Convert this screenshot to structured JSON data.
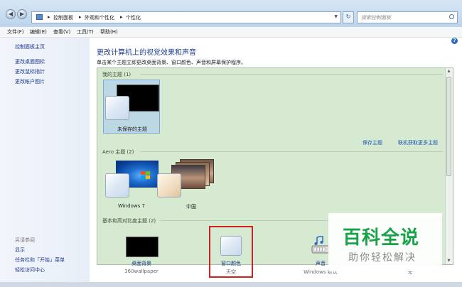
{
  "address_bar": {
    "crumbs": [
      "控制面板",
      "外观和个性化",
      "个性化"
    ],
    "search_placeholder": "搜索控制面板"
  },
  "menu": [
    "文件(F)",
    "编辑(E)",
    "查看(V)",
    "工具(T)",
    "帮助(H)"
  ],
  "left_pane": {
    "home": "控制面板主页",
    "links": [
      "更改桌面图标",
      "更改鼠标指针",
      "更改帐户图片"
    ],
    "see_also_title": "另请参阅",
    "see_also": [
      "显示",
      "任务栏和「开始」菜单",
      "轻松访问中心"
    ]
  },
  "main": {
    "title": "更改计算机上的视觉效果和声音",
    "subtitle": "单击某个主题立即更改桌面背景、窗口颜色、声音和屏幕保护程序。",
    "help_icon": "?",
    "groups": {
      "my_themes": "我的主题 (1)",
      "aero_themes": "Aero 主题 (2)",
      "basic_themes": "基本和高对比度主题 (2)"
    },
    "themes": {
      "unsaved": "未保存的主题",
      "windows7": "Windows 7",
      "china": "中国"
    },
    "actions": {
      "save_theme": "保存主题",
      "get_more": "联机获取更多主题"
    },
    "bottom_options": [
      {
        "label": "桌面背景",
        "sub": "360wallpaper"
      },
      {
        "label": "窗口颜色",
        "sub": "天空"
      },
      {
        "label": "声音",
        "sub": "Windows 默认"
      },
      {
        "label": "",
        "sub": "无"
      }
    ]
  },
  "watermark": {
    "big": "百科全说",
    "small": "助你轻松解决"
  },
  "colors": {
    "link": "#1c3a8c",
    "theme_bg": "#d5ead0",
    "highlight_box": "#d02020",
    "watermark_green": "#1aa24a"
  }
}
